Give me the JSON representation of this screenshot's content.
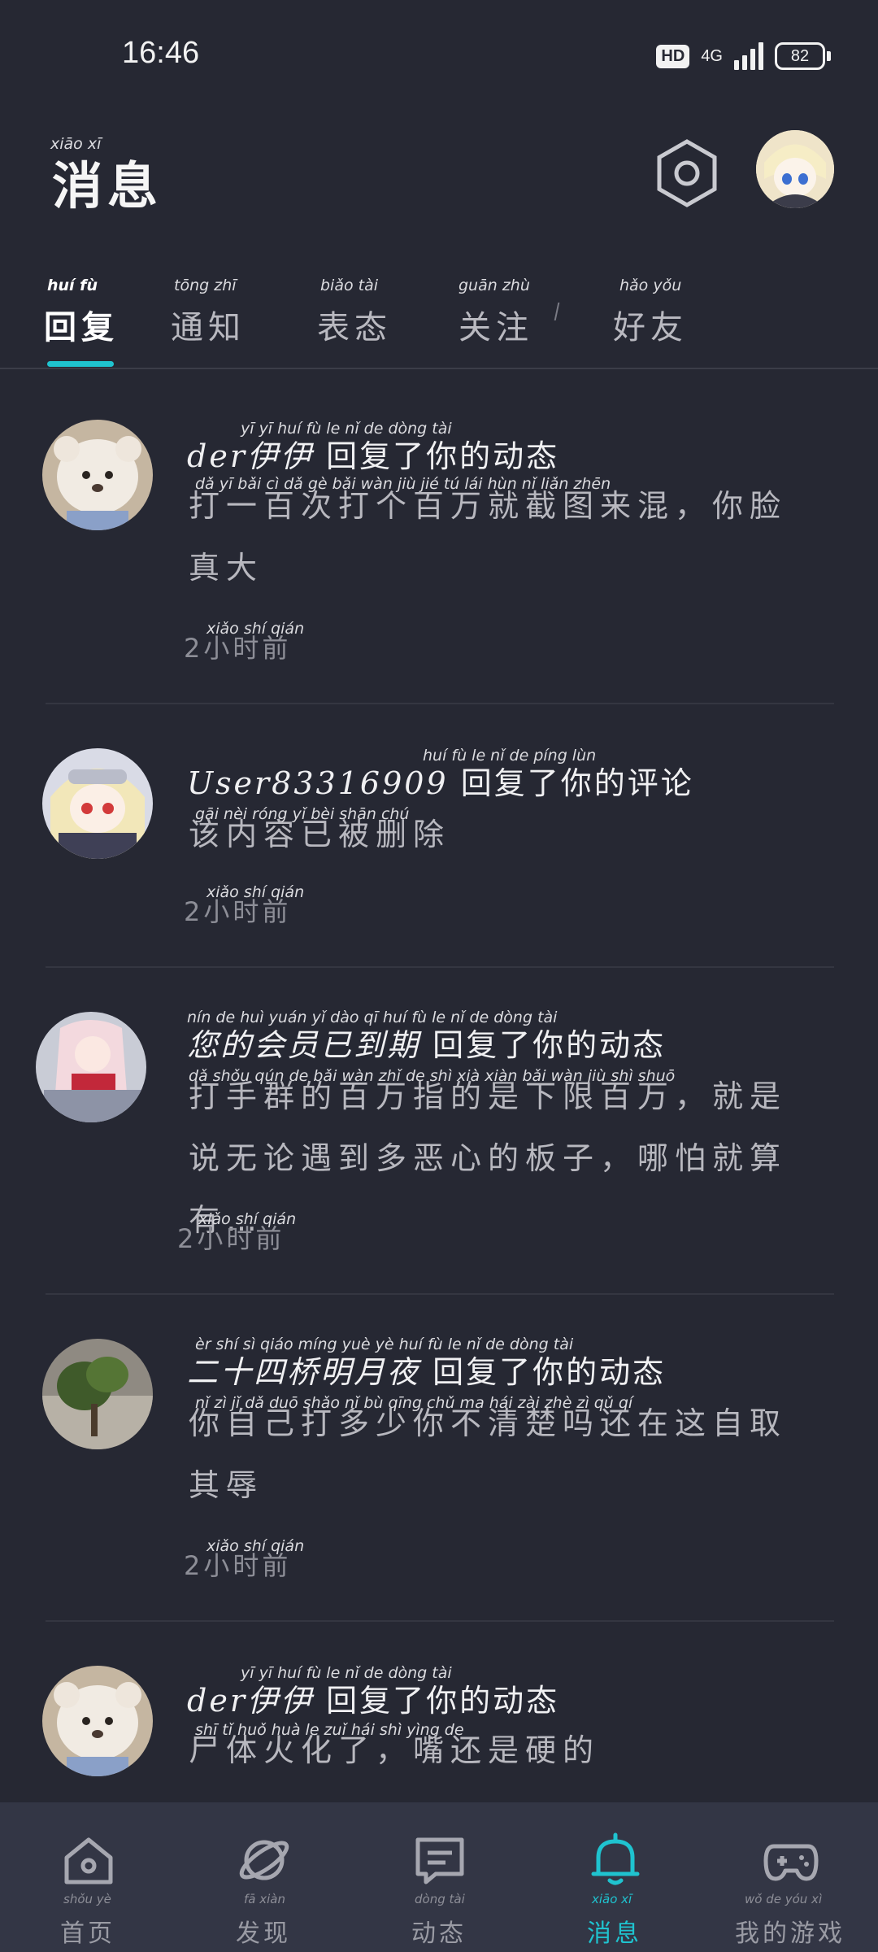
{
  "status_bar": {
    "time": "16:46",
    "hd": "HD",
    "network": "4G",
    "battery": "82"
  },
  "header": {
    "title": "消息",
    "title_pinyin": "xiāo   xī"
  },
  "tabs": [
    {
      "label": "回复",
      "pinyin": "huí   fù",
      "active": true
    },
    {
      "label": "通知",
      "pinyin": "tōng  zhī",
      "active": false
    },
    {
      "label": "表态",
      "pinyin": "biǎo  tài",
      "active": false
    },
    {
      "label": "关注",
      "pinyin": "guān  zhù",
      "active": false
    },
    {
      "label": "好友",
      "pinyin": "hǎo   yǒu",
      "active": false
    }
  ],
  "messages": [
    {
      "name": "der伊伊",
      "action": "回复了你的动态",
      "title_pinyin": "yī   yī     huí   fù   le   nǐ   de  dòng  tài",
      "body": "打一百次打个百万就截图来混，你脸真大",
      "body_pinyin": "dǎ   yī   bǎi   cì   dǎ   gè   bǎi  wàn  jiù   jié   tú   lái  hùn          nǐ  liǎn zhēn",
      "time": "2小时前",
      "time_pinyin": "xiǎo  shí  qián"
    },
    {
      "name": "User83316909",
      "action": "回复了你的评论",
      "title_pinyin": "huí   fù    le   nǐ   de  píng  lùn",
      "body": "该内容已被删除",
      "body_pinyin": "gāi  nèi  róng  yǐ   bèi  shān  chú",
      "time": "2小时前",
      "time_pinyin": "xiǎo  shí  qián"
    },
    {
      "name": "您的会员已到期",
      "action": "回复了你的动态",
      "title_pinyin": "nín  de   huì yuán  yǐ   dào   qī      huí   fù   le   nǐ   de  dòng  tài",
      "body": "打手群的百万指的是下限百万，就是说无论遇到多恶心的板子，哪怕就算有…",
      "body_pinyin": "dǎ  shǒu qún  de   bǎi  wàn  zhǐ   de   shì  xià  xiàn  bǎi  wàn         jiù  shì shuō",
      "time": "2小时前",
      "time_pinyin": "xiǎo  shí  qián"
    },
    {
      "name": "二十四桥明月夜",
      "action": "回复了你的动态",
      "title_pinyin": "èr   shí   sì  qiáo míng yuè  yè      huí   fù   le   nǐ   de  dòng  tài",
      "body": "你自己打多少你不清楚吗还在这自取其辱",
      "body_pinyin": "nǐ   zì   jǐ   dǎ  duō shǎo  nǐ   bù  qīng chǔ  ma  hái  zài  zhè  zì   qǔ   qí",
      "time": "2小时前",
      "time_pinyin": "xiǎo  shí  qián"
    },
    {
      "name": "der伊伊",
      "action": "回复了你的动态",
      "title_pinyin": "yī   yī     huí   fù   le   nǐ   de  dòng  tài",
      "body": "尸体火化了，嘴还是硬的",
      "body_pinyin": "shī   tǐ  huǒ huà  le         zuǐ  hái  shì yìng  de",
      "time": "",
      "time_pinyin": ""
    }
  ],
  "bottom_nav": [
    {
      "label": "首页",
      "pinyin": "shǒu  yè",
      "icon": "home-icon",
      "active": false
    },
    {
      "label": "发现",
      "pinyin": "fā   xiàn",
      "icon": "planet-icon",
      "active": false
    },
    {
      "label": "动态",
      "pinyin": "dòng  tài",
      "icon": "chat-card-icon",
      "active": false
    },
    {
      "label": "消息",
      "pinyin": "xiāo   xī",
      "icon": "bell-icon",
      "active": true
    },
    {
      "label": "我的游戏",
      "pinyin": "wǒ   de  yóu   xì",
      "icon": "gamepad-icon",
      "active": false
    }
  ],
  "colors": {
    "background": "#262833",
    "accent": "#1fc3cf",
    "nav_background": "#333645"
  }
}
